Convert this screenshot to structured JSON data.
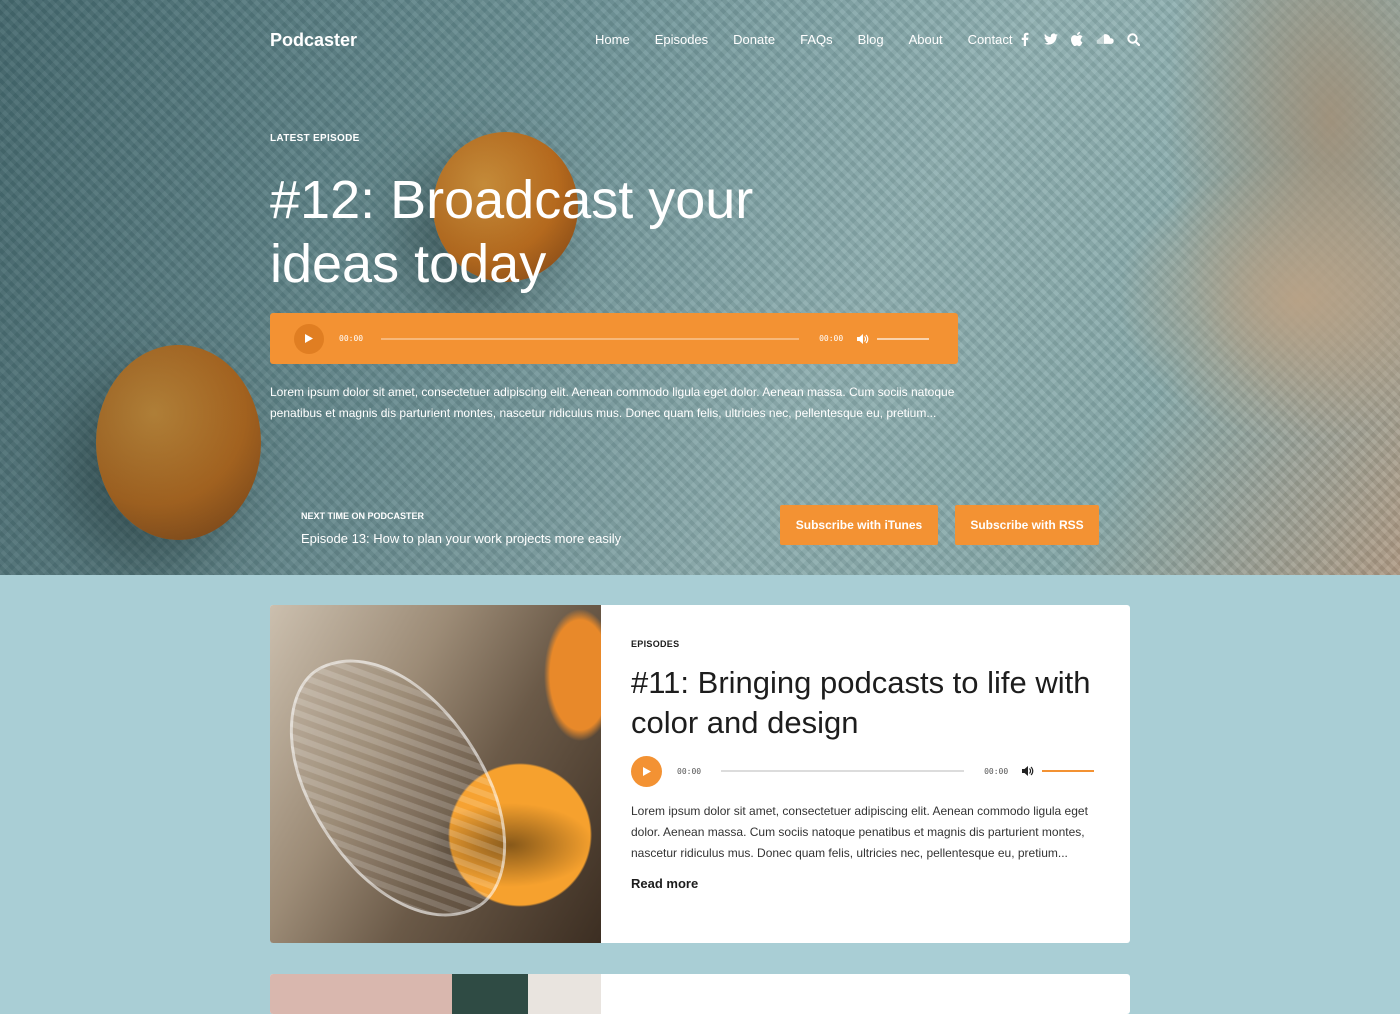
{
  "site": {
    "logo": "Podcaster"
  },
  "nav": [
    "Home",
    "Episodes",
    "Donate",
    "FAQs",
    "Blog",
    "About",
    "Contact"
  ],
  "social_icons": [
    "facebook-icon",
    "twitter-icon",
    "apple-icon",
    "soundcloud-icon",
    "search-icon"
  ],
  "hero": {
    "kicker": "LATEST EPISODE",
    "title": "#12: Broadcast your ideas today",
    "player": {
      "current_time": "00:00",
      "duration": "00:00"
    },
    "excerpt": "Lorem ipsum dolor sit amet, consectetuer adipiscing elit. Aenean commodo ligula eget dolor. Aenean massa. Cum sociis natoque penatibus et magnis dis parturient montes, nascetur ridiculus mus. Donec quam felis, ultricies nec, pellentesque eu, pretium...",
    "next_label": "NEXT TIME ON PODCASTER",
    "next_title": "Episode 13: How to plan your work projects more easily",
    "subscribe_itunes": "Subscribe with iTunes",
    "subscribe_rss": "Subscribe with RSS"
  },
  "episode_card": {
    "kicker": "EPISODES",
    "title": "#11: Bringing podcasts to life with color and design",
    "player": {
      "current_time": "00:00",
      "duration": "00:00"
    },
    "excerpt": "Lorem ipsum dolor sit amet, consectetuer adipiscing elit. Aenean commodo ligula eget dolor. Aenean massa. Cum sociis natoque penatibus et magnis dis parturient montes, nascetur ridiculus mus. Donec quam felis, ultricies nec, pellentesque eu, pretium...",
    "read_more": "Read more"
  },
  "colors": {
    "accent": "#f39233",
    "page_bg": "#a9ced5"
  }
}
